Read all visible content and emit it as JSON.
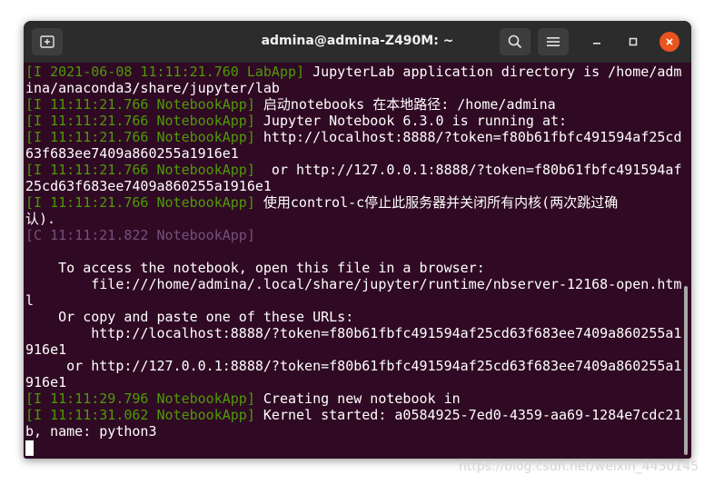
{
  "window": {
    "title": "admina@admina-Z490M: ~"
  },
  "terminal": {
    "lines": [
      {
        "prefix": "[I 2021-06-08 11:11:21.760 LabApp]",
        "color": "green",
        "text": " JupyterLab application directory is /home/adm"
      },
      {
        "prefix": "",
        "color": "",
        "text": "ina/anaconda3/share/jupyter/lab"
      },
      {
        "prefix": "[I 11:11:21.766 NotebookApp]",
        "color": "green",
        "text": " 启动notebooks 在本地路径: /home/admina"
      },
      {
        "prefix": "[I 11:11:21.766 NotebookApp]",
        "color": "green",
        "text": " Jupyter Notebook 6.3.0 is running at:"
      },
      {
        "prefix": "[I 11:11:21.766 NotebookApp]",
        "color": "green",
        "text": " http://localhost:8888/?token=f80b61fbfc491594af25cd"
      },
      {
        "prefix": "",
        "color": "",
        "text": "63f683ee7409a860255a1916e1"
      },
      {
        "prefix": "[I 11:11:21.766 NotebookApp]",
        "color": "green",
        "text": "  or http://127.0.0.1:8888/?token=f80b61fbfc491594af"
      },
      {
        "prefix": "",
        "color": "",
        "text": "25cd63f683ee7409a860255a1916e1"
      },
      {
        "prefix": "[I 11:11:21.766 NotebookApp]",
        "color": "green",
        "text": " 使用control-c停止此服务器并关闭所有内核(两次跳过确"
      },
      {
        "prefix": "",
        "color": "",
        "text": "认)."
      },
      {
        "prefix": "[C 11:11:21.822 NotebookApp]",
        "color": "magenta",
        "text": ""
      },
      {
        "prefix": "",
        "color": "",
        "text": ""
      },
      {
        "prefix": "",
        "color": "",
        "text": "    To access the notebook, open this file in a browser:"
      },
      {
        "prefix": "",
        "color": "",
        "text": "        file:///home/admina/.local/share/jupyter/runtime/nbserver-12168-open.htm"
      },
      {
        "prefix": "",
        "color": "",
        "text": "l"
      },
      {
        "prefix": "",
        "color": "",
        "text": "    Or copy and paste one of these URLs:"
      },
      {
        "prefix": "",
        "color": "",
        "text": "        http://localhost:8888/?token=f80b61fbfc491594af25cd63f683ee7409a860255a1"
      },
      {
        "prefix": "",
        "color": "",
        "text": "916e1"
      },
      {
        "prefix": "",
        "color": "",
        "text": "     or http://127.0.0.1:8888/?token=f80b61fbfc491594af25cd63f683ee7409a860255a1"
      },
      {
        "prefix": "",
        "color": "",
        "text": "916e1"
      },
      {
        "prefix": "[I 11:11:29.796 NotebookApp]",
        "color": "green",
        "text": " Creating new notebook in"
      },
      {
        "prefix": "[I 11:11:31.062 NotebookApp]",
        "color": "green",
        "text": " Kernel started: a0584925-7ed0-4359-aa69-1284e7cdc21"
      },
      {
        "prefix": "",
        "color": "",
        "text": "b, name: python3"
      }
    ]
  },
  "watermark": "https://blog.csdn.net/weixin_4430145",
  "colors": {
    "background": "#300a24",
    "green": "#4e9a06",
    "magenta": "#75507b",
    "close": "#e9541f"
  },
  "icons": {
    "new_tab": "new-tab-icon",
    "search": "search-icon",
    "menu": "hamburger-menu-icon",
    "minimize": "minimize-icon",
    "maximize": "maximize-icon",
    "close": "close-icon"
  }
}
